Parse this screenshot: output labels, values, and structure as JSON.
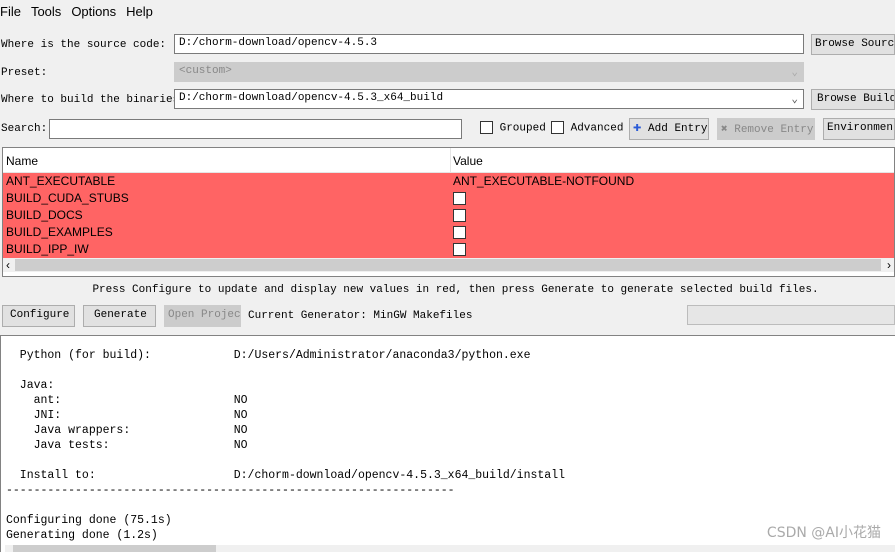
{
  "menu": [
    "File",
    "Tools",
    "Options",
    "Help"
  ],
  "source": {
    "label": "Where is the source code:",
    "value": "D:/chorm-download/opencv-4.5.3",
    "browse": "Browse Source..."
  },
  "preset": {
    "label": "Preset:",
    "value": "<custom>"
  },
  "build": {
    "label": "Where to build the binaries:",
    "value": "D:/chorm-download/opencv-4.5.3_x64_build",
    "browse": "Browse Build..."
  },
  "search": {
    "label": "Search:",
    "value": ""
  },
  "toolbar": {
    "grouped": "Grouped",
    "advanced": "Advanced",
    "add_entry": "Add Entry",
    "remove_entry": "Remove Entry",
    "environment": "Environment..."
  },
  "table": {
    "headers": [
      "Name",
      "Value"
    ],
    "rows": [
      {
        "name": "ANT_EXECUTABLE",
        "value": "ANT_EXECUTABLE-NOTFOUND"
      },
      {
        "name": "BUILD_CUDA_STUBS",
        "value": ""
      },
      {
        "name": "BUILD_DOCS",
        "value": ""
      },
      {
        "name": "BUILD_EXAMPLES",
        "value": ""
      },
      {
        "name": "BUILD_IPP_IW",
        "value": ""
      }
    ],
    "row_color": "#ff6464"
  },
  "hint": "Press Configure to update and display new values in red, then press Generate to generate selected build files.",
  "actions": {
    "configure": "Configure",
    "generate": "Generate",
    "open_project": "Open Project",
    "generator": "Current Generator: MinGW Makefiles"
  },
  "output": "  Python (for build):            D:/Users/Administrator/anaconda3/python.exe\n\n  Java:\n    ant:                         NO\n    JNI:                         NO\n    Java wrappers:               NO\n    Java tests:                  NO\n\n  Install to:                    D:/chorm-download/opencv-4.5.3_x64_build/install\n-----------------------------------------------------------------\n\nConfiguring done (75.1s)\nGenerating done (1.2s)",
  "watermark": "CSDN @AI小花猫"
}
